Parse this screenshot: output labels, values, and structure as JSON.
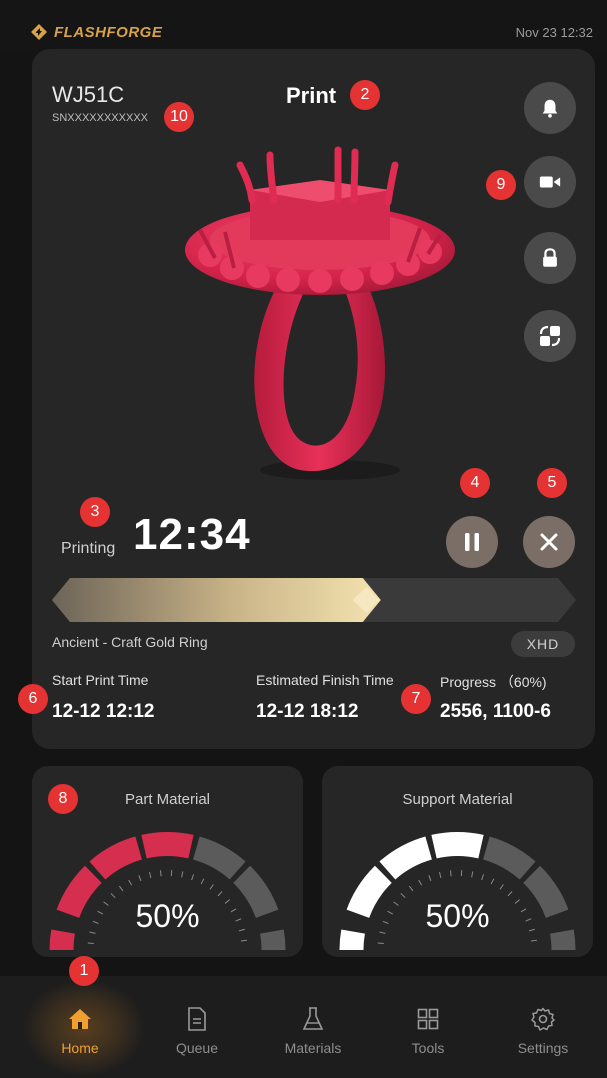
{
  "header": {
    "brand": "FLASHFORGE",
    "datetime": "Nov 23  12:32"
  },
  "printer": {
    "model": "WJ51C",
    "serial": "SNXXXXXXXXXXX",
    "title": "Print"
  },
  "status": {
    "label": "Printing",
    "time": "12:34",
    "progress": 0.6
  },
  "job": {
    "file_name": "Ancient - Craft Gold Ring",
    "quality": "XHD",
    "start_label": "Start Print Time",
    "start_value": "12-12 12:12",
    "finish_label": "Estimated Finish Time",
    "finish_value": "12-12 18:12",
    "progress_label": "Progress  （60%)",
    "progress_value": "2556,  1100-6"
  },
  "materials": {
    "part": {
      "title": "Part Material",
      "percent": "50%",
      "level": 0.5,
      "color": "#d62e4e"
    },
    "support": {
      "title": "Support Material",
      "percent": "50%",
      "level": 0.5,
      "color": "#ffffff"
    }
  },
  "side_buttons": [
    "bell-icon",
    "video-camera-icon",
    "lock-icon",
    "switch-icon"
  ],
  "badges": {
    "b1": "1",
    "b2": "2",
    "b3": "3",
    "b4": "4",
    "b5": "5",
    "b6": "6",
    "b7": "7",
    "b8": "8",
    "b9": "9",
    "b10": "10"
  },
  "nav": {
    "home": "Home",
    "queue": "Queue",
    "materials": "Materials",
    "tools": "Tools",
    "settings": "Settings",
    "active_color": "#f0a030"
  },
  "colors": {
    "accent": "#e53232",
    "ring": "#e0274f",
    "bar_fill": "#e8d29a"
  }
}
